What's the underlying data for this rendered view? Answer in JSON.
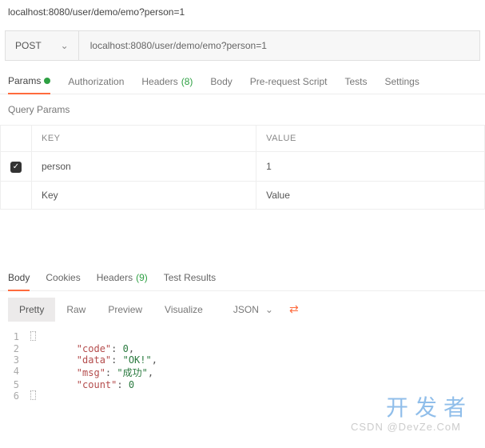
{
  "top_url": "localhost:8080/user/demo/emo?person=1",
  "request": {
    "method": "POST",
    "url": "localhost:8080/user/demo/emo?person=1"
  },
  "tabs": {
    "params": "Params",
    "auth": "Authorization",
    "headers": "Headers",
    "headers_count": "(8)",
    "body": "Body",
    "prereq": "Pre-request Script",
    "tests": "Tests",
    "settings": "Settings"
  },
  "query_params_label": "Query Params",
  "table": {
    "key_h": "KEY",
    "val_h": "VALUE",
    "rows": [
      {
        "checked": true,
        "key": "person",
        "value": "1"
      }
    ],
    "placeholder_key": "Key",
    "placeholder_value": "Value"
  },
  "resp_tabs": {
    "body": "Body",
    "cookies": "Cookies",
    "headers": "Headers",
    "headers_count": "(9)",
    "results": "Test Results"
  },
  "view": {
    "pretty": "Pretty",
    "raw": "Raw",
    "preview": "Preview",
    "visualize": "Visualize",
    "format": "JSON"
  },
  "json_lines": [
    {
      "n": "1",
      "t": "brace"
    },
    {
      "n": "2",
      "indent": "        ",
      "key": "\"code\"",
      "colon": ": ",
      "val": "0",
      "vt": "num",
      "comma": ","
    },
    {
      "n": "3",
      "indent": "        ",
      "key": "\"data\"",
      "colon": ": ",
      "val": "\"OK!\"",
      "vt": "str",
      "comma": ","
    },
    {
      "n": "4",
      "indent": "        ",
      "key": "\"msg\"",
      "colon": ": ",
      "val": "\"成功\"",
      "vt": "str",
      "comma": ","
    },
    {
      "n": "5",
      "indent": "        ",
      "key": "\"count\"",
      "colon": ": ",
      "val": "0",
      "vt": "num",
      "comma": ""
    },
    {
      "n": "6",
      "t": "brace"
    }
  ],
  "watermark1": "开发者",
  "watermark2": "CSDN @DevZe.CoM"
}
